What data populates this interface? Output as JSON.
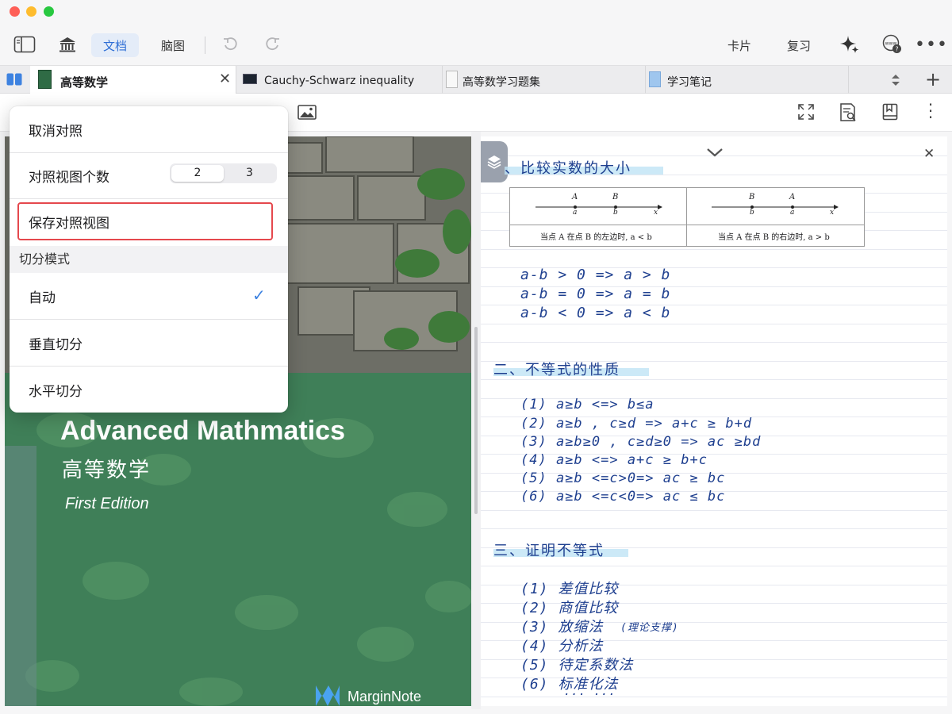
{
  "window": {
    "traffic_colors": [
      "#fe5f57",
      "#febc2e",
      "#28c840"
    ]
  },
  "toolbar": {
    "segments": [
      {
        "label": "文档",
        "active": true
      },
      {
        "label": "脑图",
        "active": false
      }
    ],
    "right_labels": [
      "卡片",
      "复习"
    ],
    "accent": "#2f6fd6"
  },
  "tabs": [
    {
      "label": "高等数学",
      "active": true
    },
    {
      "label": "Cauchy-Schwarz inequality",
      "active": false
    },
    {
      "label": "高等数学习题集",
      "active": false
    },
    {
      "label": "学习笔记",
      "active": false
    }
  ],
  "menu": {
    "cancel_compare": "取消对照",
    "view_count_label": "对照视图个数",
    "view_count_options": [
      "2",
      "3"
    ],
    "view_count_selected": "2",
    "save_compare": "保存对照视图",
    "split_mode_header": "切分模式",
    "split_auto": "自动",
    "split_vertical": "垂直切分",
    "split_horizontal": "水平切分",
    "selected_mode": "自动",
    "highlight_color": "#e5484d"
  },
  "book": {
    "title_en": "Advanced Mathmatics",
    "title_zh": "高等数学",
    "edition": "First Edition",
    "brand": "MarginNote"
  },
  "notes": {
    "section1": "、比较实数的大小",
    "diagram": {
      "left": {
        "labels_top": [
          "A",
          "B"
        ],
        "labels_bottom": [
          "a",
          "b"
        ],
        "axis": "x",
        "caption": "当点 A 在点 B 的左边时, a < b"
      },
      "right": {
        "labels_top": [
          "B",
          "A"
        ],
        "labels_bottom": [
          "b",
          "a"
        ],
        "axis": "x",
        "caption": "当点 A 在点 B 的右边时, a > b"
      }
    },
    "compare_lines": [
      "a-b > 0  =>  a > b",
      "a-b = 0  =>  a = b",
      "a-b < 0  =>  a < b"
    ],
    "section2": "二、不等式的性质",
    "props": [
      "(1) a≥b  <=>  b≤a",
      "(2) a≥b , c≥d =>  a+c ≥ b+d",
      "(3) a≥b≥0 , c≥d≥0  =>  ac ≥bd",
      "(4) a≥b  <=>  a+c ≥ b+c",
      "(5) a≥b  <=c>0=>  ac ≥ bc",
      "(6) a≥b  <=c<0=>  ac ≤ bc"
    ],
    "section3": "三、证明不等式",
    "methods": [
      "(1) 差值比较",
      "(2) 商值比较",
      "(3) 放缩法",
      "(4) 分析法",
      "(5) 待定系数法",
      "(6) 标准化法"
    ],
    "methods_note": "(理论支撑)",
    "ellipsis": "··· ···"
  }
}
